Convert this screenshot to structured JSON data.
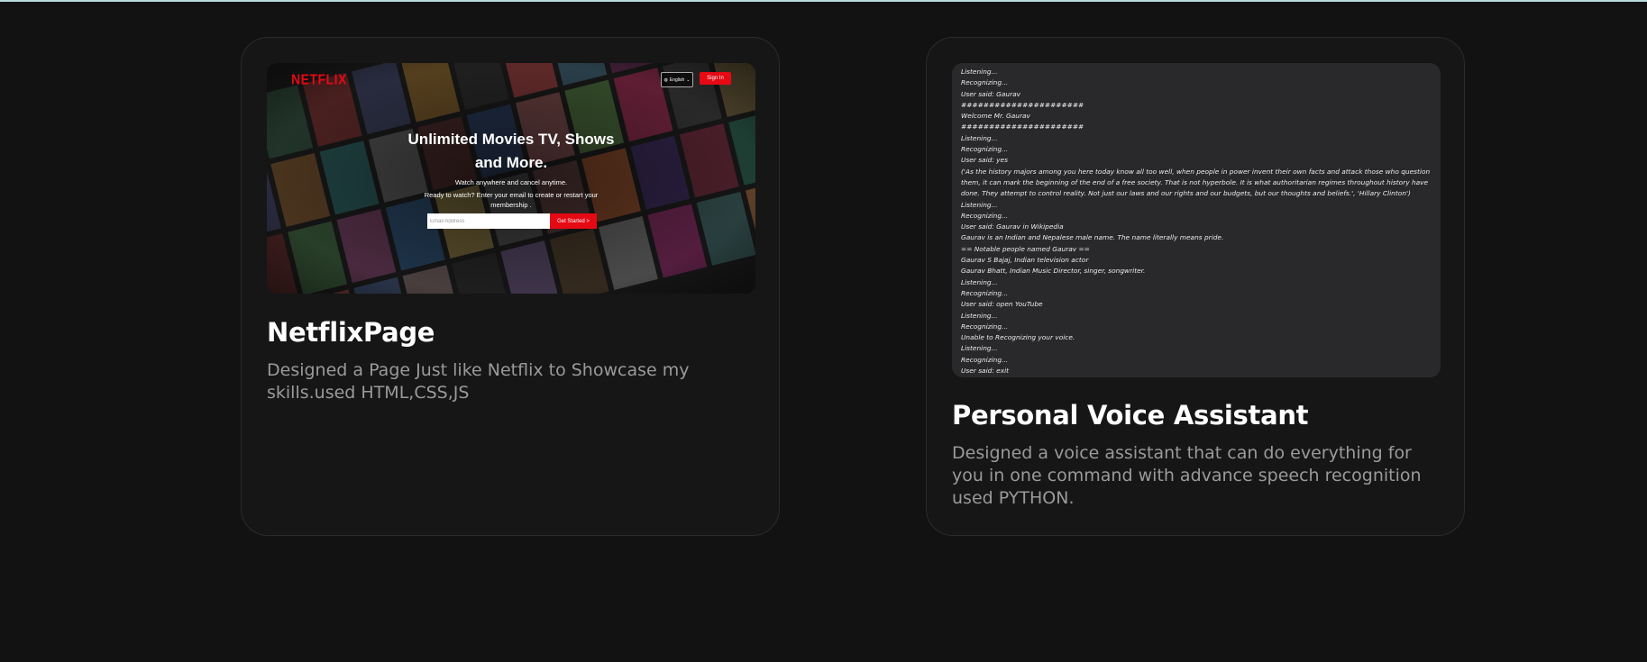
{
  "colors": {
    "background": "#121212",
    "card": "#161616",
    "netflix_red": "#e50914",
    "accent_line": "#b9d9de"
  },
  "projects": [
    {
      "title": "NetflixPage",
      "description": "Designed a Page Just like Netflix to Showcase my skills.used HTML,CSS,JS",
      "preview": {
        "logo": "NETFLIX",
        "language": "English",
        "sign_in": "Sign In",
        "headline": "Unlimited Movies TV, Shows and More.",
        "subtitle": "Watch anywhere and cancel anytime.",
        "cta_text": "Ready to watch? Enter your email to create or restart your membership .",
        "email_placeholder": "Email Address",
        "get_started": "Get Started >"
      }
    },
    {
      "title": "Personal Voice Assistant",
      "description": "Designed a voice assistant that can do everything for you in one command with advance speech recognition used PYTHON.",
      "console_lines": [
        "Listening...",
        "Recognizing...",
        "User said: Gaurav",
        "######################",
        "Welcome Mr. Gaurav",
        "######################",
        "Listening...",
        "Recognizing...",
        "User said: yes",
        "('As the history majors among you here today know all too well, when people in power invent their own facts and attack those who question them, it can mark the beginning of the end of a free society. That is not hyperbole. It is what authoritarian regimes throughout history have done. They attempt to control reality. Not just our laws and our rights and our budgets, but our thoughts and beliefs.', 'Hillary Clinton')",
        "Listening...",
        "Recognizing...",
        "User said: Gaurav in Wikipedia",
        "Gaurav is an Indian and Nepalese male name. The name literally means pride.",
        "== Notable people named Gaurav ==",
        "Gaurav S Bajaj, Indian television actor",
        "Gaurav Bhatt, Indian Music Director, singer, songwriter.",
        "Listening...",
        "Recognizing...",
        "User said: open YouTube",
        "Listening...",
        "Recognizing...",
        "Unable to Recognizing your voice.",
        "Listening...",
        "Recognizing...",
        "User said: exit"
      ]
    }
  ]
}
